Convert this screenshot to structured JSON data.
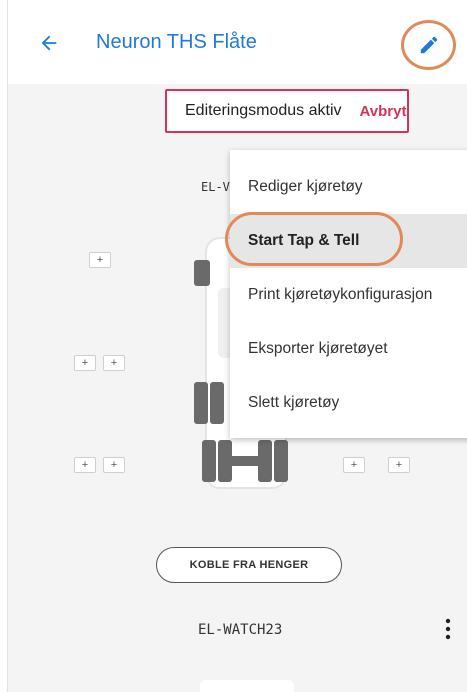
{
  "header": {
    "title": "Neuron THS Flåte",
    "back_icon": "arrow-left-icon",
    "edit_icon": "pencil-icon",
    "accent": "#1f7bd6"
  },
  "edit_banner": {
    "text": "Editeringsmodus aktiv",
    "cancel_label": "Avbryt",
    "accent": "#d6335a"
  },
  "vehicle_top": {
    "label": "EL-V"
  },
  "axle_controls": {
    "plus_label": "+"
  },
  "menu": {
    "items": [
      {
        "label": "Rediger kjøretøy"
      },
      {
        "label": "Start Tap & Tell"
      },
      {
        "label": "Print kjøretøykonfigurasjon"
      },
      {
        "label": "Eksporter kjøretøyet"
      },
      {
        "label": "Slett kjøretøy"
      }
    ]
  },
  "bottom": {
    "detach_label": "KOBLE FRA HENGER",
    "vehicle_label": "EL-WATCH23",
    "more_icon": "more-vertical-icon"
  },
  "highlight_color": "#e08a5a"
}
